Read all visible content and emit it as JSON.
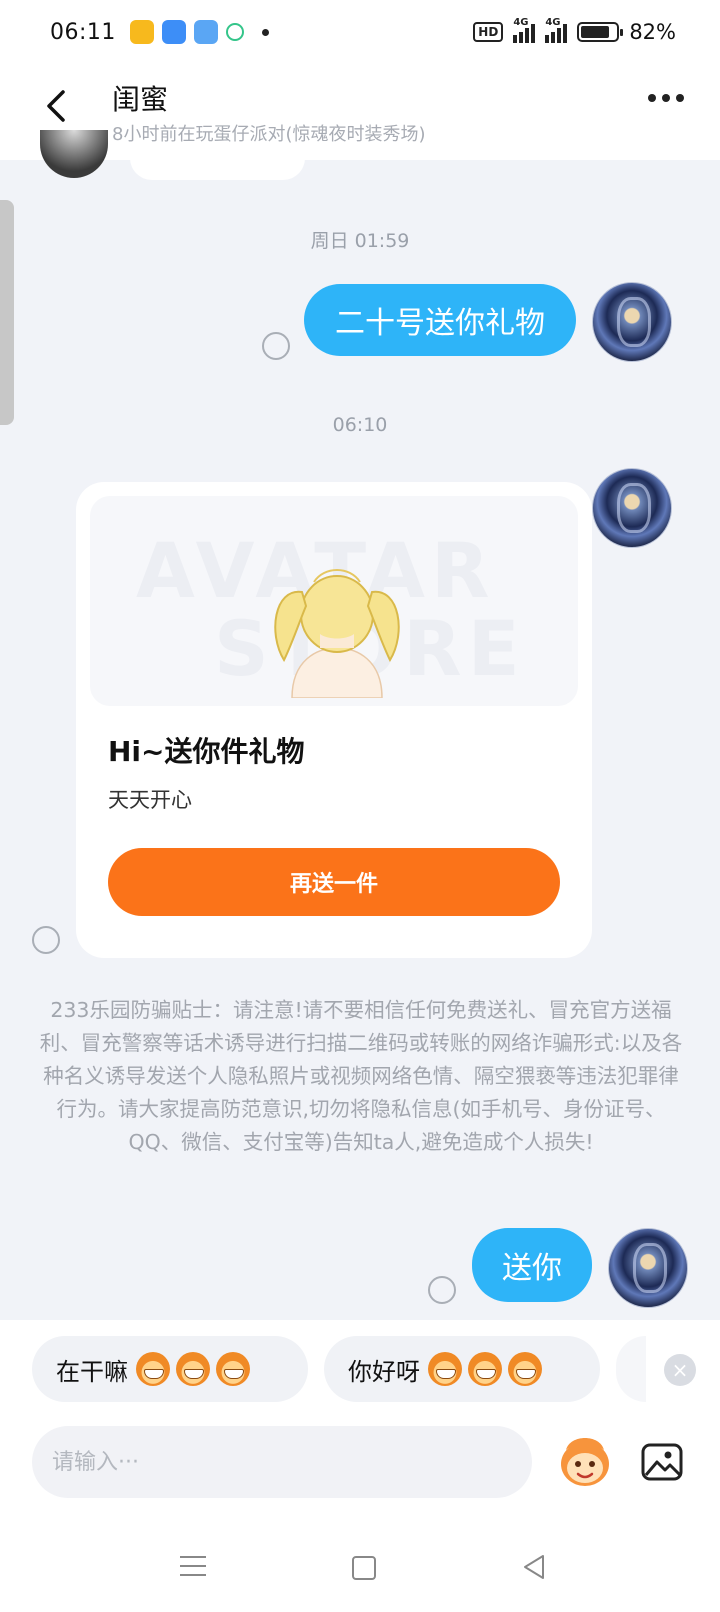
{
  "status_bar": {
    "time": "06:11",
    "hd_label": "HD",
    "network_1": "4G",
    "network_2": "4G",
    "battery": "82%",
    "battery_fraction": 0.82
  },
  "header": {
    "title": "闺蜜",
    "subtitle": "8小时前在玩蛋仔派对(惊魂夜时装秀场)",
    "back_icon": "chevron-left-icon",
    "more_icon": "more-dots-icon"
  },
  "messages": [
    {
      "type": "time",
      "text": "周日  01:59"
    },
    {
      "type": "text",
      "sender": "me",
      "text": "二十号送你礼物"
    },
    {
      "type": "time",
      "text": "06:10"
    },
    {
      "type": "gift",
      "sender": "me",
      "title": "Hi~送你件礼物",
      "message": "天天开心",
      "button_label": "再送一件",
      "watermark_1": "AVATAR",
      "watermark_2": "STORE"
    },
    {
      "type": "notice",
      "text": "233乐园防骗贴士：请注意!请不要相信任何免费送礼、冒充官方送福利、冒充警察等话术诱导进行扫描二维码或转账的网络诈骗形式:以及各种名义诱导发送个人隐私照片或视频网络色情、隔空猥亵等违法犯罪律行为。请大家提高防范意识,切勿将隐私信息(如手机号、身份证号、QQ、微信、支付宝等)告知ta人,避免造成个人损失!"
    },
    {
      "type": "text",
      "sender": "me",
      "text": "送你"
    }
  ],
  "quick_replies": [
    {
      "label": "在干嘛",
      "emoji_count": 3
    },
    {
      "label": "你好呀",
      "emoji_count": 3
    }
  ],
  "input": {
    "placeholder": "请输入···",
    "value": ""
  },
  "colors": {
    "bubble_blue": "#2eb4f8",
    "gift_button_orange": "#fb7319",
    "background": "#f1f3f8"
  }
}
